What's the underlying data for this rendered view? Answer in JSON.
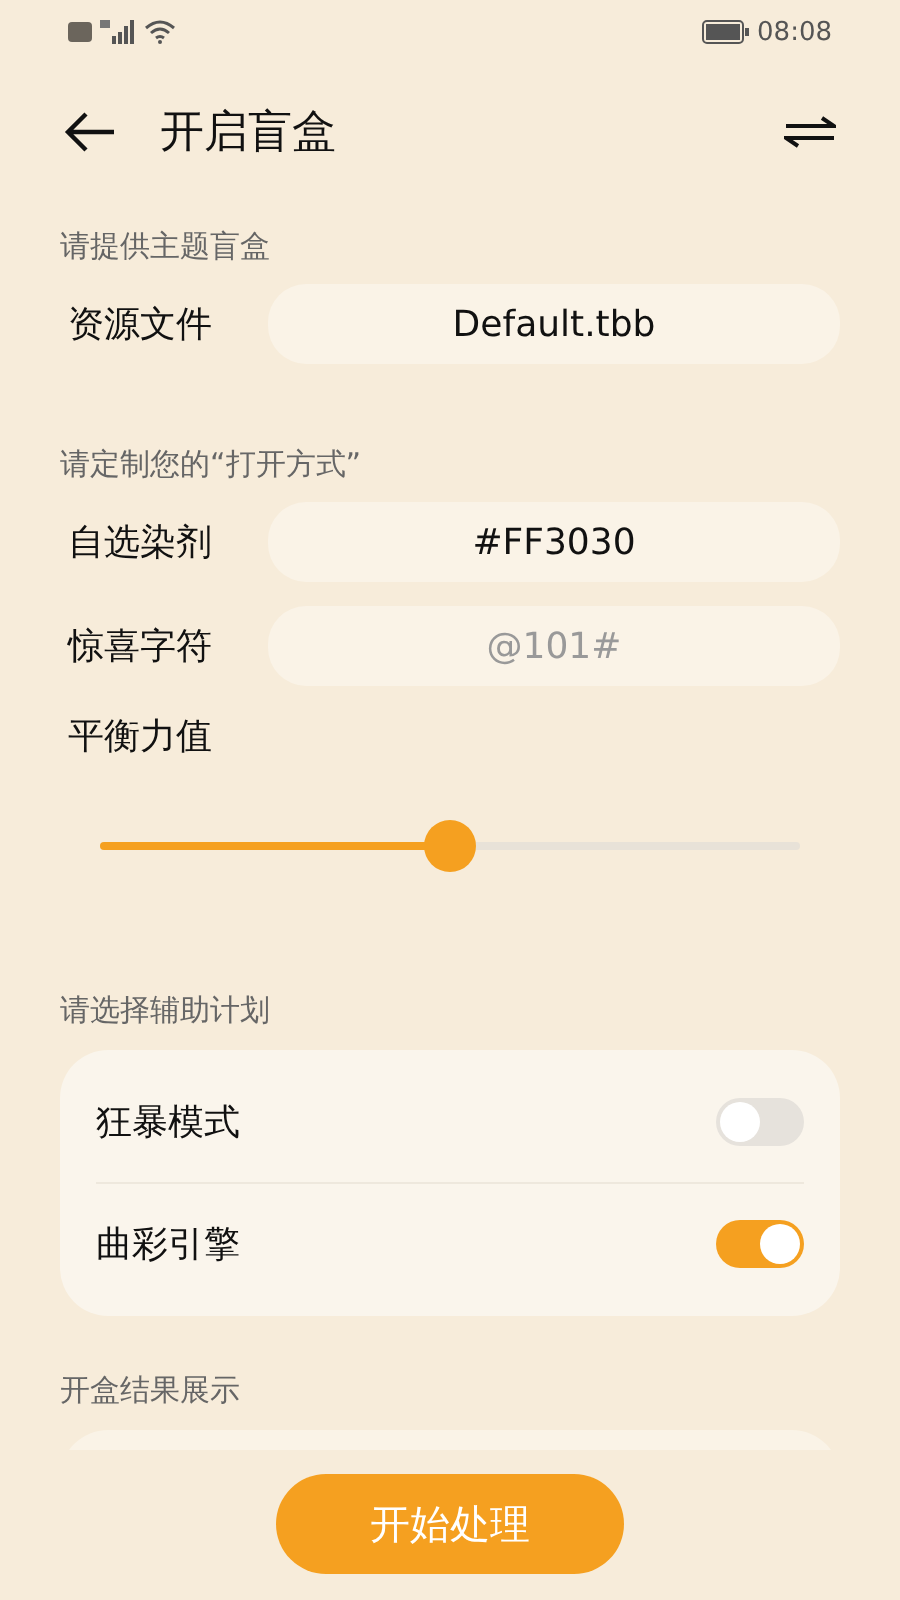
{
  "status_bar": {
    "time": "08:08"
  },
  "header": {
    "title": "开启盲盒"
  },
  "sections": [
    {
      "title": "请提供主题盲盒",
      "items": [
        {
          "kind": "field",
          "label": "资源文件",
          "value": "Default.tbb"
        }
      ]
    },
    {
      "title": "请定制您的“打开方式”",
      "items": [
        {
          "kind": "field",
          "label": "自选染剂",
          "value": "#FF3030"
        },
        {
          "kind": "field",
          "label": "惊喜字符",
          "placeholder": "@101#"
        },
        {
          "kind": "slider",
          "label": "平衡力值",
          "level": 0.5
        }
      ]
    },
    {
      "title": "请选择辅助计划",
      "items": [
        {
          "kind": "toggle",
          "label": "狂暴模式",
          "on": false
        },
        {
          "kind": "toggle",
          "label": "曲彩引擎",
          "on": true
        }
      ]
    },
    {
      "title": "开盒结果展示",
      "items": [
        {
          "kind": "result"
        }
      ]
    }
  ],
  "action_button": {
    "label": "开始处理"
  }
}
